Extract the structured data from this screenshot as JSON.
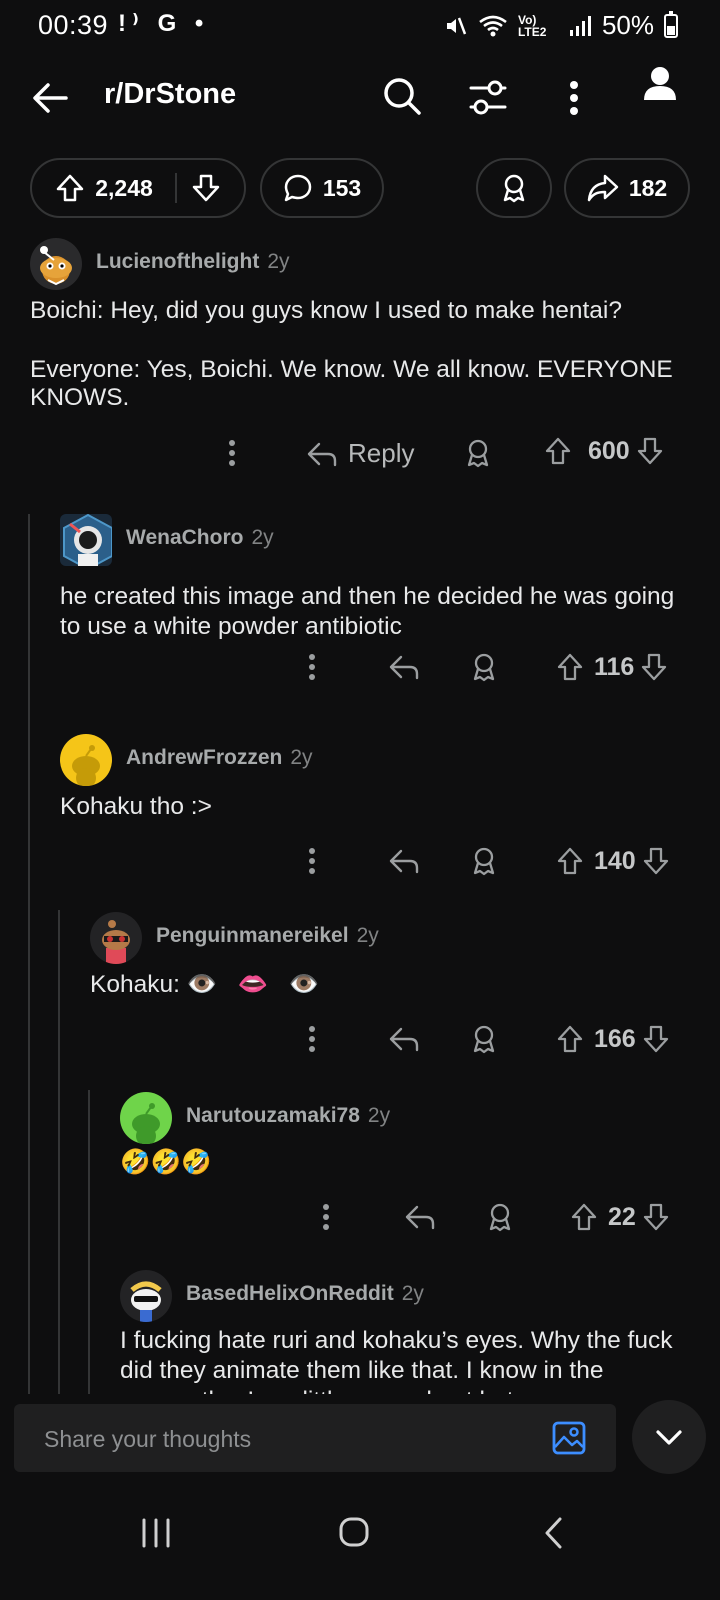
{
  "status": {
    "time": "00:39",
    "notifications": "!⁾ G •",
    "network": "Vo) LTE2",
    "battery": "50%"
  },
  "topbar": {
    "title": "r/DrStone",
    "back_icon": "arrow-left-icon",
    "search_icon": "search-icon",
    "filter_icon": "sort-icon",
    "menu_icon": "more-vertical-icon",
    "profile_icon": "profile-icon"
  },
  "post_actions": {
    "upvotes": "2,248",
    "comments": "153",
    "shares": "182"
  },
  "comments": [
    {
      "username": "Lucienofthelight",
      "age": "2y",
      "lines": [
        "Boichi: Hey, did you guys know I used to make hentai?",
        "",
        "Everyone: Yes, Boichi. We know. We all know. EVERYONE KNOWS."
      ],
      "reply_label": "Reply",
      "votes": "600"
    },
    {
      "username": "WenaChoro",
      "age": "2y",
      "text": "he created this image and then he decided he was going to use a white powder antibiotic",
      "votes": "116"
    },
    {
      "username": "AndrewFrozzen",
      "age": "2y",
      "text": "Kohaku tho :>",
      "votes": "140"
    },
    {
      "username": "Penguinmanereikel",
      "age": "2y",
      "text": "Kohaku: 👁️   👄   👁️",
      "votes": "166"
    },
    {
      "username": "Narutouzamaki78",
      "age": "2y",
      "text": "🤣🤣🤣",
      "votes": "22"
    },
    {
      "username": "BasedHelixOnReddit",
      "age": "2y",
      "text": "I fucking hate ruri and kohaku’s eyes. Why the fuck did they animate them like that. I know in the manga they’re a little spaced out but geez"
    }
  ],
  "composer": {
    "placeholder": "Share your thoughts"
  },
  "colors": {
    "background": "#0e0e0f",
    "composer_icon": "#3d8eff"
  }
}
